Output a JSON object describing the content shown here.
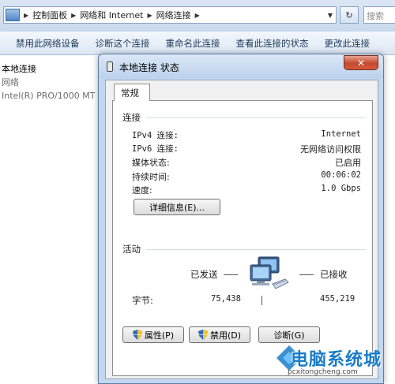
{
  "address_bar": {
    "segments": [
      "控制面板",
      "网络和 Internet",
      "网络连接"
    ],
    "search_placeholder": "搜索"
  },
  "toolbar": {
    "buttons": [
      "禁用此网络设备",
      "诊断这个连接",
      "重命名此连接",
      "查看此连接的状态",
      "更改此连接"
    ]
  },
  "connection_item": {
    "name": "本地连接",
    "network": "网络",
    "adapter": "Intel(R) PRO/1000 MT"
  },
  "dialog": {
    "title": "本地连接 状态",
    "close_label": "✕",
    "tab_label": "常规",
    "connection_group": "连接",
    "rows": [
      {
        "label": "IPv4 连接:",
        "value": "Internet"
      },
      {
        "label": "IPv6 连接:",
        "value": "无网络访问权限"
      },
      {
        "label": "媒体状态:",
        "value": "已启用"
      },
      {
        "label": "持续时间:",
        "value": "00:06:02"
      },
      {
        "label": "速度:",
        "value": "1.0 Gbps"
      }
    ],
    "details_button": "详细信息(E)...",
    "activity_group": "活动",
    "sent_label": "已发送",
    "received_label": "已接收",
    "bytes_label": "字节:",
    "bytes_sent": "75,438",
    "bytes_received": "455,219",
    "properties_button": "属性(P)",
    "disable_button": "禁用(D)",
    "diagnose_button": "诊断(G)"
  },
  "watermark": {
    "text": "电脑系统城",
    "url": "pcxitongcheng.com"
  },
  "colors": {
    "title_bar": "#c4d7ef",
    "close_button": "#c44a2d",
    "toolbar_text": "#1e395b",
    "watermark": "#1a7cc7"
  }
}
